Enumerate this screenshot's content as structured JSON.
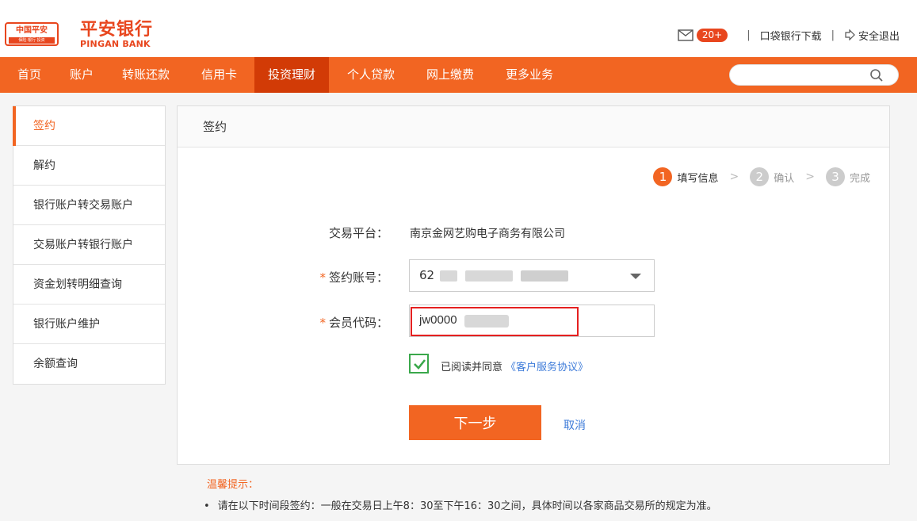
{
  "header": {
    "logo_badge_top": "中国平安",
    "logo_badge_bottom": "保险·银行·投资",
    "brand_cn": "平安银行",
    "brand_en": "PINGAN BANK",
    "mail_count": "20+",
    "pocket_bank": "口袋银行下载",
    "separator": "|",
    "logout": "安全退出"
  },
  "nav": {
    "items": [
      {
        "label": "首页",
        "active": false
      },
      {
        "label": "账户",
        "active": false
      },
      {
        "label": "转账还款",
        "active": false
      },
      {
        "label": "信用卡",
        "active": false
      },
      {
        "label": "投资理财",
        "active": true
      },
      {
        "label": "个人贷款",
        "active": false
      },
      {
        "label": "网上缴费",
        "active": false
      },
      {
        "label": "更多业务",
        "active": false
      }
    ],
    "search_placeholder": ""
  },
  "sidebar": {
    "items": [
      {
        "label": "签约",
        "active": true
      },
      {
        "label": "解约",
        "active": false
      },
      {
        "label": "银行账户转交易账户",
        "active": false
      },
      {
        "label": "交易账户转银行账户",
        "active": false
      },
      {
        "label": "资金划转明细查询",
        "active": false
      },
      {
        "label": "银行账户维护",
        "active": false
      },
      {
        "label": "余额查询",
        "active": false
      }
    ]
  },
  "panel": {
    "title": "签约",
    "steps": [
      {
        "num": "1",
        "label": "填写信息",
        "active": true
      },
      {
        "num": "2",
        "label": "确认",
        "active": false
      },
      {
        "num": "3",
        "label": "完成",
        "active": false
      }
    ],
    "step_arrow": ">",
    "platform_label": "交易平台：",
    "platform_value": "南京金网艺购电子商务有限公司",
    "required_mark": "*",
    "account_label": "签约账号：",
    "account_value": "62",
    "member_label": "会员代码：",
    "member_value": "jw0000",
    "agree_text": "已阅读并同意",
    "agree_link": "《客户服务协议》",
    "next_button": "下一步",
    "cancel": "取消"
  },
  "tips": {
    "title": "温馨提示：",
    "bullet": "•",
    "text": "请在以下时间段签约：一般在交易日上午8：30至下午16：30之间，具体时间以各家商品交易所的规定为准。"
  },
  "colors": {
    "brand_orange": "#f26522",
    "nav_active": "#d23b06",
    "link_blue": "#3d7bd9",
    "check_green": "#3aa84b",
    "highlight_red": "#e52020"
  }
}
